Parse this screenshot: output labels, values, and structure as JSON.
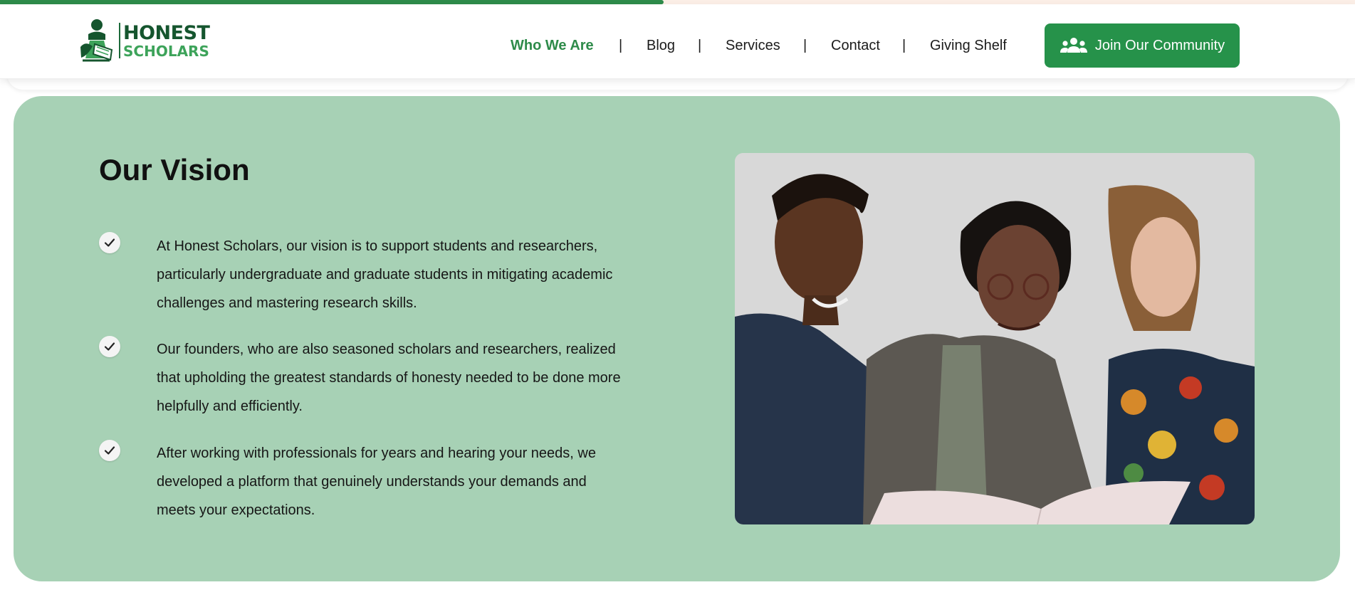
{
  "progress": {
    "value_percent": 49
  },
  "brand": {
    "name_top": "HONEST",
    "name_bottom": "SCHOLARS",
    "colors": {
      "dark_green": "#15552e",
      "light_green": "#3da35a",
      "accent": "#26924a",
      "section_bg": "#a7d1b5"
    }
  },
  "nav": {
    "items": [
      {
        "label": "Who We Are",
        "active": true
      },
      {
        "label": "Blog",
        "active": false
      },
      {
        "label": "Services",
        "active": false
      },
      {
        "label": "Contact",
        "active": false
      },
      {
        "label": "Giving Shelf",
        "active": false
      }
    ],
    "separator": "|"
  },
  "cta": {
    "label": "Join Our Community",
    "icon": "users-icon"
  },
  "vision": {
    "title": "Our Vision",
    "points": [
      {
        "icon": "check-icon",
        "text": "At Honest Scholars, our vision is to support students and researchers, particularly undergraduate and graduate students in mitigating academic challenges and mastering research skills."
      },
      {
        "icon": "check-icon",
        "text": "Our founders, who are also seasoned scholars and researchers, realized that upholding the greatest standards of honesty needed to be done more helpfully and efficiently."
      },
      {
        "icon": "check-icon",
        "text": "After working with professionals for years and hearing your needs, we developed a platform that genuinely understands your demands and meets your expectations."
      }
    ]
  }
}
